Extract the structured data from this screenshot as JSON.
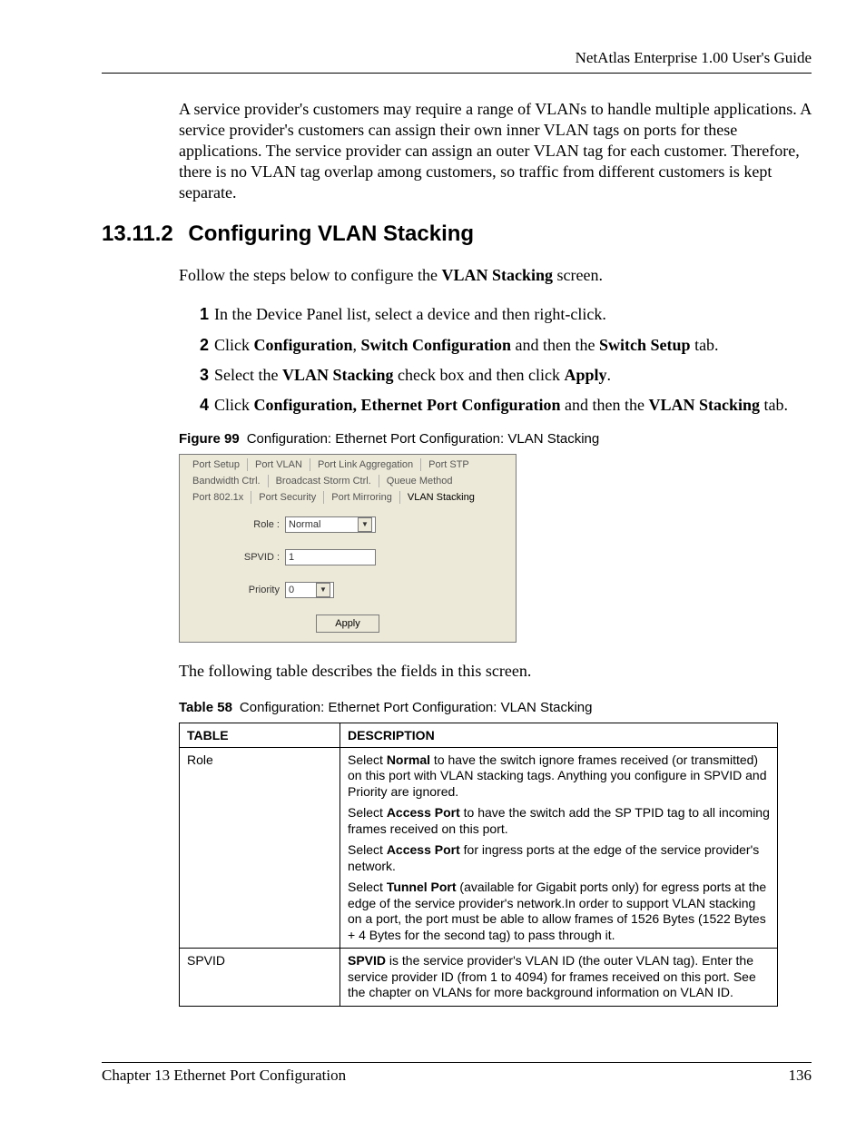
{
  "header": {
    "running": "NetAtlas Enterprise 1.00 User's Guide"
  },
  "intro_para": "A service provider's customers may require a range of VLANs to handle multiple applications. A service provider's customers can assign their own inner VLAN tags on ports for these applications. The service provider can assign an outer VLAN tag for each customer. Therefore, there is no VLAN tag overlap among customers, so traffic from different customers is kept separate.",
  "section": {
    "number": "13.11.2",
    "title": "Configuring VLAN Stacking",
    "lead": "Follow the steps below to configure the ",
    "lead_bold": "VLAN Stacking",
    "lead_tail": " screen."
  },
  "steps": [
    {
      "n": "1",
      "runs": [
        {
          "t": "In the Device Panel list, select a device and then right-click."
        }
      ]
    },
    {
      "n": "2",
      "runs": [
        {
          "t": "Click "
        },
        {
          "t": "Configuration",
          "b": true
        },
        {
          "t": ", "
        },
        {
          "t": "Switch Configuration",
          "b": true
        },
        {
          "t": " and then the "
        },
        {
          "t": "Switch Setup",
          "b": true
        },
        {
          "t": " tab."
        }
      ]
    },
    {
      "n": "3",
      "runs": [
        {
          "t": "Select the "
        },
        {
          "t": "VLAN Stacking",
          "b": true
        },
        {
          "t": " check box and then click "
        },
        {
          "t": "Apply",
          "b": true
        },
        {
          "t": "."
        }
      ]
    },
    {
      "n": "4",
      "runs": [
        {
          "t": "Click "
        },
        {
          "t": "Configuration, Ethernet Port Configuration",
          "b": true
        },
        {
          "t": " and then the "
        },
        {
          "t": "VLAN Stacking",
          "b": true
        },
        {
          "t": " tab."
        }
      ]
    }
  ],
  "figure": {
    "label": "Figure 99",
    "caption": "Configuration: Ethernet Port Configuration: VLAN Stacking"
  },
  "shot": {
    "tabs_row1": [
      "Port Setup",
      "Port VLAN",
      "Port Link Aggregation",
      "Port STP"
    ],
    "tabs_row2": [
      "Bandwidth Ctrl.",
      "Broadcast Storm Ctrl.",
      "Queue Method"
    ],
    "tabs_row3": [
      "Port 802.1x",
      "Port Security",
      "Port Mirroring",
      "VLAN Stacking"
    ],
    "active_tab": "VLAN Stacking",
    "role_label": "Role :",
    "role_value": "Normal",
    "spvid_label": "SPVID :",
    "spvid_value": "1",
    "priority_label": "Priority",
    "priority_value": "0",
    "apply": "Apply"
  },
  "after_shot": "The following table describes the fields in this screen.",
  "table_cap": {
    "label": "Table 58",
    "caption": "Configuration: Ethernet Port Configuration: VLAN Stacking"
  },
  "table": {
    "head": [
      "TABLE",
      "DESCRIPTION"
    ],
    "rows": [
      {
        "label": "Role",
        "paras": [
          [
            {
              "t": "Select "
            },
            {
              "t": "Normal",
              "b": true
            },
            {
              "t": " to have the switch ignore frames received (or transmitted) on this port with VLAN stacking tags. Anything you configure in SPVID and Priority are ignored."
            }
          ],
          [
            {
              "t": "Select "
            },
            {
              "t": "Access Port",
              "b": true
            },
            {
              "t": " to have the switch add the SP TPID tag to all incoming frames received on this port."
            }
          ],
          [
            {
              "t": "Select "
            },
            {
              "t": "Access Port",
              "b": true
            },
            {
              "t": " for ingress ports at the edge of the service provider's network."
            }
          ],
          [
            {
              "t": "Select "
            },
            {
              "t": "Tunnel Port",
              "b": true
            },
            {
              "t": " (available for Gigabit ports only) for egress ports at the edge of the service provider's network.In order to support VLAN stacking on a port, the port must be able to allow frames of 1526 Bytes (1522 Bytes + 4 Bytes for the second tag) to pass through it."
            }
          ]
        ]
      },
      {
        "label": "SPVID",
        "paras": [
          [
            {
              "t": "SPVID",
              "b": true
            },
            {
              "t": " is the service provider's VLAN ID (the outer VLAN tag). Enter the service provider ID (from 1 to 4094) for frames received on this port. See the chapter on VLANs for more background information on VLAN ID."
            }
          ]
        ]
      }
    ]
  },
  "footer": {
    "left": "Chapter 13 Ethernet Port Configuration",
    "right": "136"
  }
}
